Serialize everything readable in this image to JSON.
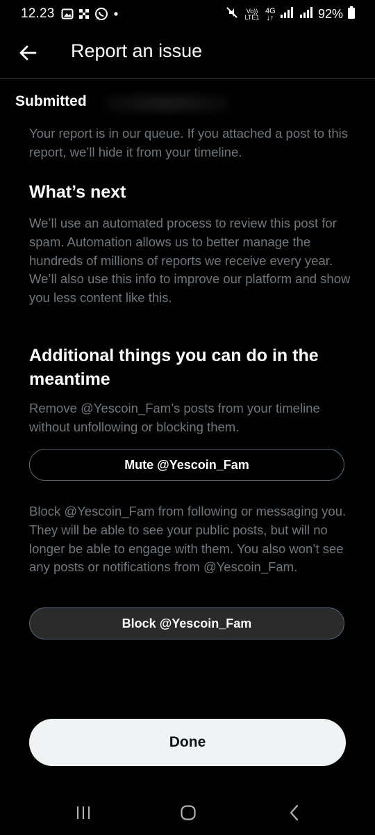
{
  "status_bar": {
    "time": "12.23",
    "battery_percent": "92%",
    "network_label": "4G",
    "volte_label": "Vo)) LTE1",
    "icons": [
      "gallery-icon",
      "grid-app-icon",
      "whatsapp-icon",
      "dot-icon",
      "mute-icon",
      "signal-icon",
      "battery-icon"
    ]
  },
  "header": {
    "title": "Report an issue",
    "back_icon": "arrow-left-icon"
  },
  "content": {
    "submitted_label": "Submitted",
    "submitted_text": "Your report is in our queue. If you attached a post to this report, we’ll hide it from your timeline.",
    "whats_next_heading": "What’s next",
    "whats_next_text": "We’ll use an automated process to review this post for spam. Automation allows us to better manage the hundreds of millions of reports we receive every year. We’ll also use this info to improve our platform and show you less content like this.",
    "additional_heading": "Additional things you can do in the meantime",
    "mute_text": "Remove @Yescoin_Fam’s posts from your timeline without unfollowing or blocking them.",
    "mute_button": "Mute @Yescoin_Fam",
    "block_text": "Block @Yescoin_Fam from following or messaging you. They will be able to see your public posts, but will no longer be able to engage with them. You also won’t see any posts or notifications from @Yescoin_Fam.",
    "block_button": "Block @Yescoin_Fam",
    "done_button": "Done"
  },
  "nav_bar": {
    "icons": [
      "recents-icon",
      "home-icon",
      "back-icon"
    ]
  },
  "colors": {
    "background": "#000000",
    "text_primary": "#e7e9ea",
    "text_secondary": "#71767b",
    "border": "#536471",
    "done_bg": "#eff3f4"
  }
}
